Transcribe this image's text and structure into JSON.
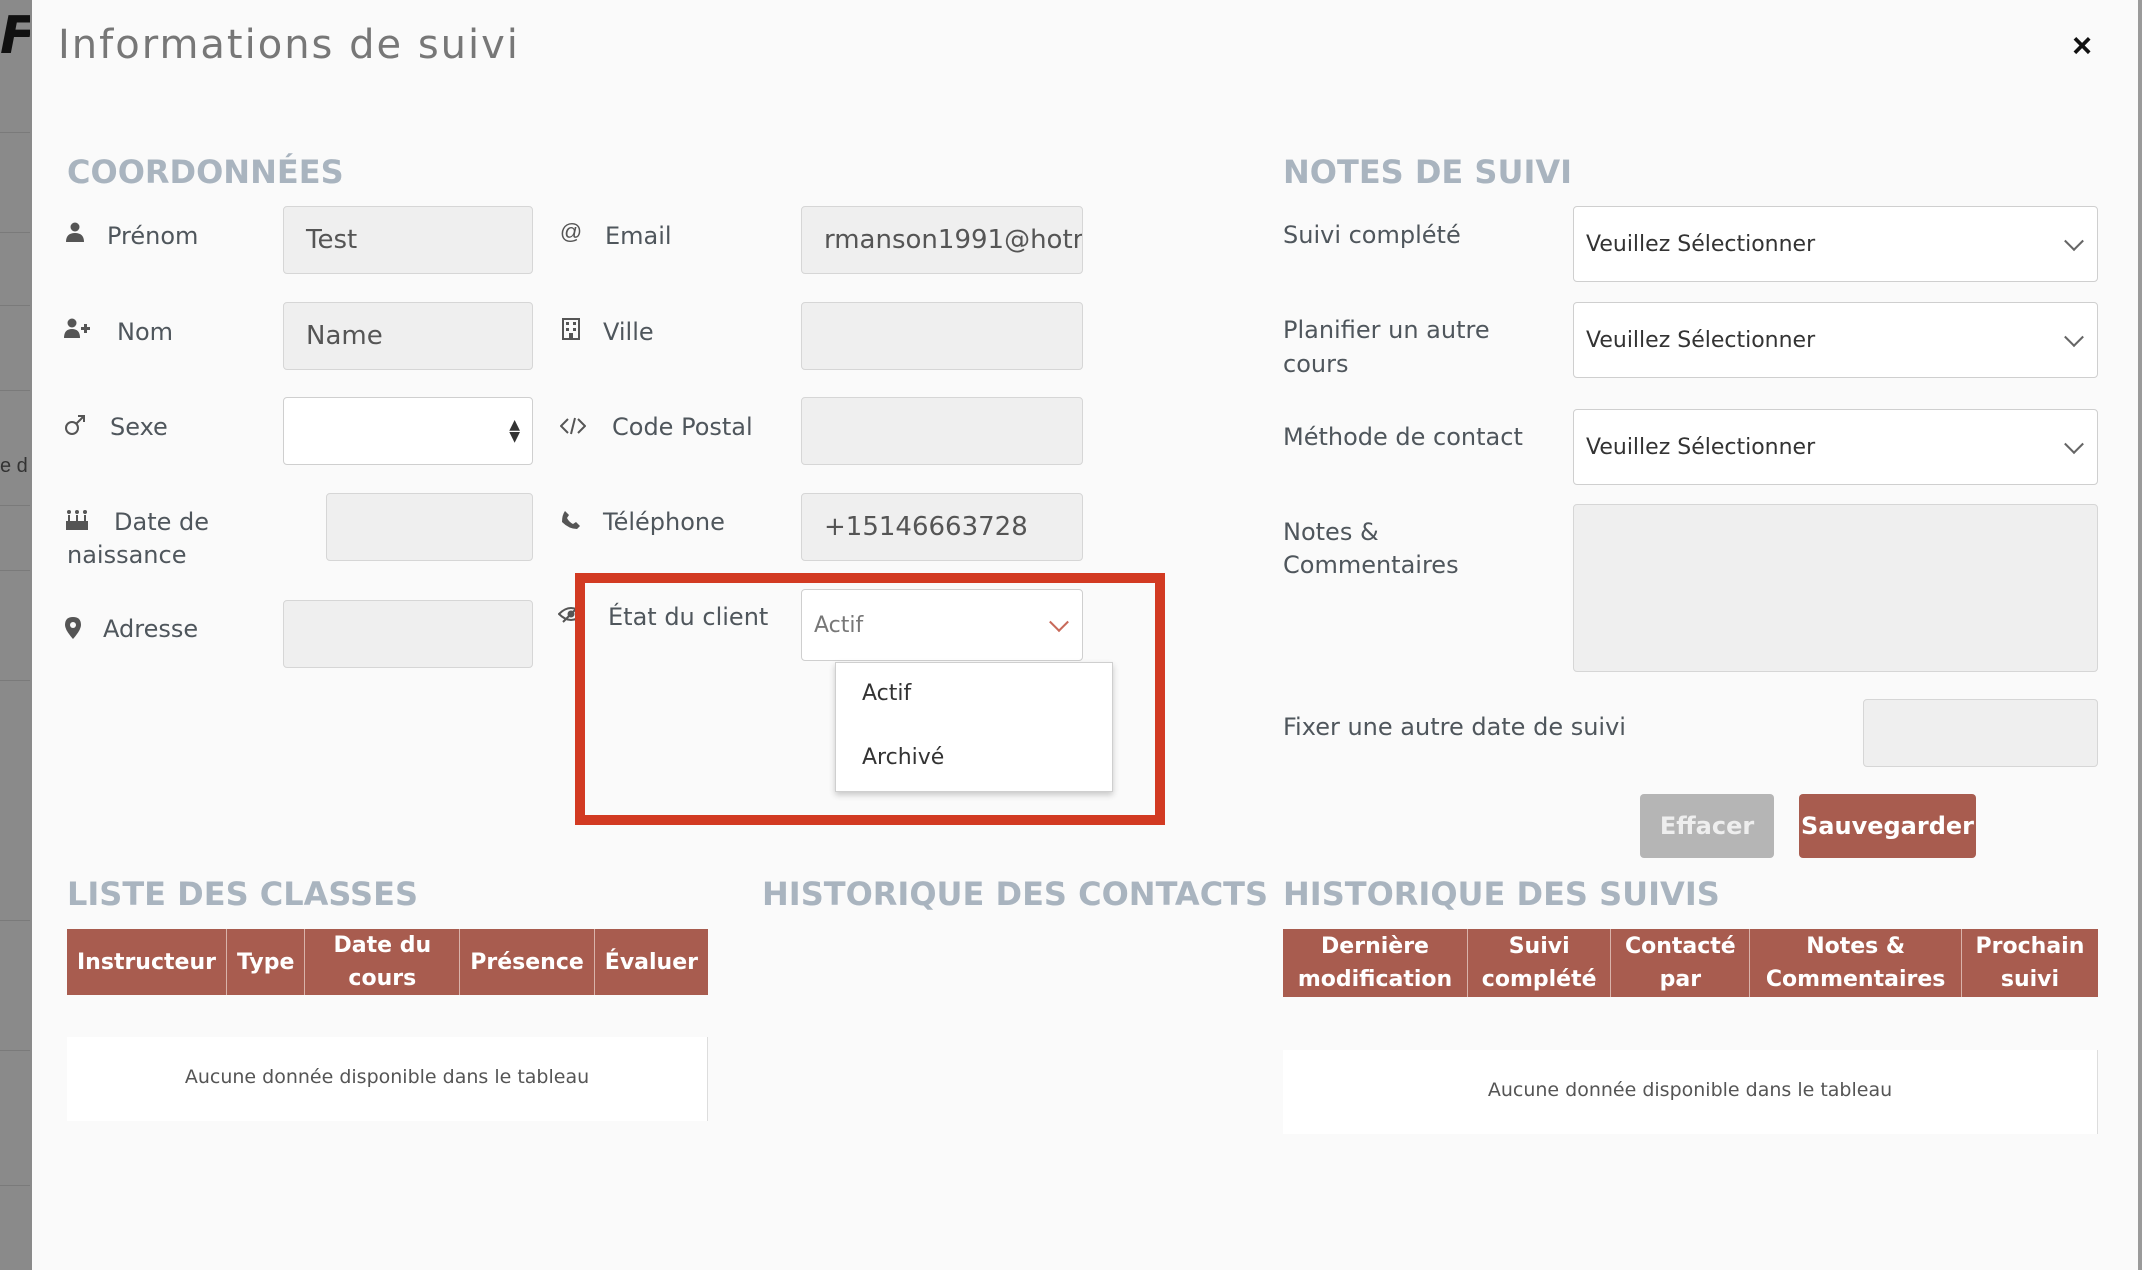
{
  "background": {
    "logo_glyph": "F",
    "text_fragment": "e d"
  },
  "modal": {
    "title": "Informations de suivi",
    "close_glyph": "×"
  },
  "coordonnees": {
    "section_title": "COORDONNÉES",
    "prenom_label": "Prénom",
    "prenom_value": "Test",
    "nom_label": "Nom",
    "nom_value": "Name",
    "sexe_label": "Sexe",
    "sexe_value": "",
    "date_label_line1": "Date de",
    "date_label_line2": "naissance",
    "date_value": "",
    "adresse_label": "Adresse",
    "adresse_value": "",
    "email_label": "Email",
    "email_value": "rmanson1991@hotm",
    "ville_label": "Ville",
    "ville_value": "",
    "code_postal_label": "Code Postal",
    "code_postal_value": "",
    "telephone_label": "Téléphone",
    "telephone_value": "+15146663728",
    "etat_label": "État du client",
    "etat_value": "Actif",
    "etat_options": [
      "Actif",
      "Archivé"
    ]
  },
  "icons": {
    "user": "user-icon",
    "user_plus": "user-plus-icon",
    "gender": "mars-icon",
    "birthday": "birthday-cake-icon",
    "address": "map-marker-icon",
    "email": "at-icon",
    "city": "building-icon",
    "postal": "code-icon",
    "phone": "phone-icon",
    "status": "eye-slash-icon"
  },
  "notes": {
    "section_title": "NOTES DE SUIVI",
    "suivi_complete_label": "Suivi complété",
    "planifier_label_line1": "Planifier un autre",
    "planifier_label_line2": "cours",
    "methode_label": "Méthode de contact",
    "select_placeholder": "Veuillez Sélectionner",
    "notes_label_line1": "Notes &",
    "notes_label_line2": "Commentaires",
    "fixer_label": "Fixer une autre date de suivi",
    "clear_button": "Effacer",
    "save_button": "Sauvegarder"
  },
  "classes": {
    "section_title": "LISTE DES CLASSES",
    "columns": [
      "Instructeur",
      "Type",
      "Date du cours",
      "Présence",
      "Évaluer"
    ],
    "empty_text": "Aucune donnée disponible dans le tableau"
  },
  "contacts": {
    "section_title": "HISTORIQUE DES CONTACTS"
  },
  "suivis": {
    "section_title": "HISTORIQUE DES SUIVIS",
    "columns": [
      {
        "l1": "Dernière",
        "l2": "modification"
      },
      {
        "l1": "Suivi",
        "l2": "complété"
      },
      {
        "l1": "Contacté",
        "l2": "par"
      },
      {
        "l1": "Notes &",
        "l2": "Commentaires"
      },
      {
        "l1": "Prochain",
        "l2": "suivi"
      }
    ],
    "empty_text": "Aucune donnée disponible dans le tableau"
  },
  "colors": {
    "accent": "#a85c4f",
    "highlight": "#d23a22",
    "section_title": "#a9b4bf"
  }
}
